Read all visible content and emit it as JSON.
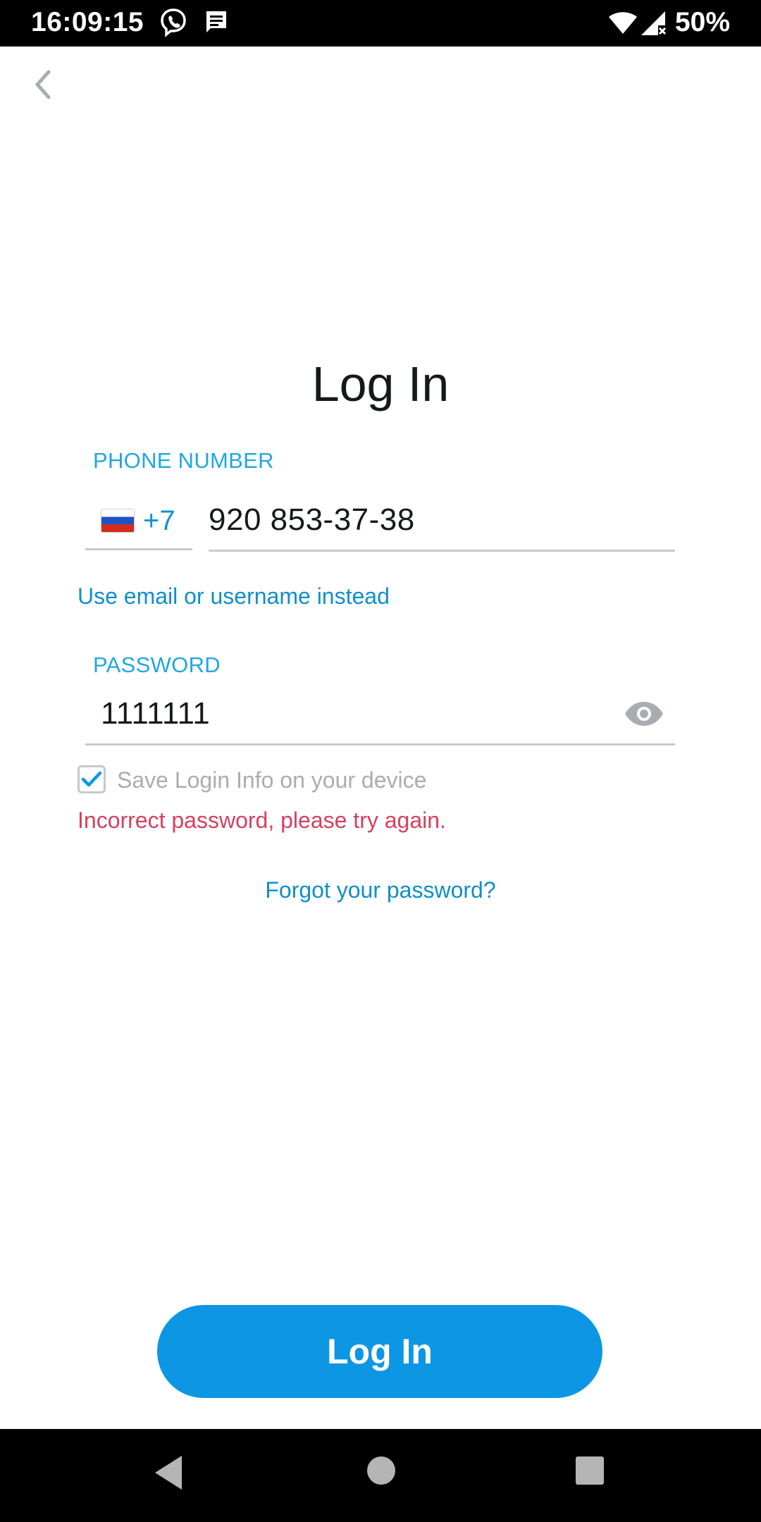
{
  "status_bar": {
    "time": "16:09:15",
    "battery": "50%",
    "icons": [
      "viber-icon",
      "message-icon",
      "wifi-icon",
      "signal-icon",
      "battery-icon"
    ]
  },
  "header": {
    "back_icon": "chevron-left-icon"
  },
  "title": "Log In",
  "phone": {
    "label": "PHONE NUMBER",
    "country_flag": "russia-flag",
    "country_code": "+7",
    "value": "920 853-37-38"
  },
  "alt_login_link": "Use email or username instead",
  "password": {
    "label": "PASSWORD",
    "value": "1111111",
    "toggle_icon": "eye-icon"
  },
  "save_login": {
    "checked": true,
    "label": "Save Login Info on your device"
  },
  "error": "Incorrect password, please try again.",
  "forgot_link": "Forgot your password?",
  "login_button": "Log In",
  "colors": {
    "accent": "#0d96e4",
    "link": "#0f8fcc",
    "label": "#1fa7df",
    "error": "#d7405f"
  },
  "nav_bar": {
    "icons": [
      "back-triangle-icon",
      "home-circle-icon",
      "recents-square-icon"
    ]
  }
}
